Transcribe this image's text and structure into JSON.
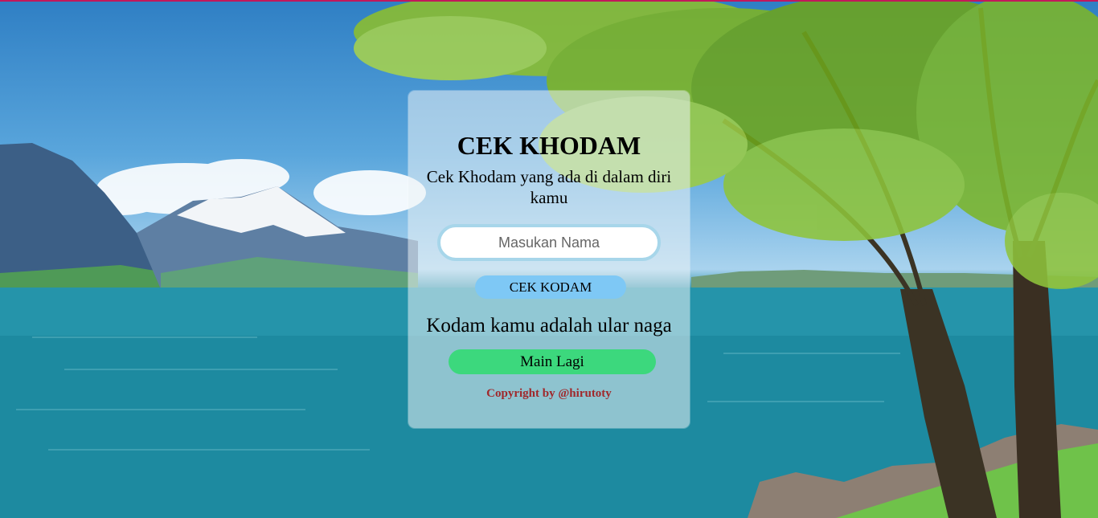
{
  "app": {
    "title": "CEK KHODAM",
    "subtitle": "Cek Khodam yang ada di dalam diri kamu"
  },
  "form": {
    "name_placeholder": "Masukan Nama",
    "name_value": "",
    "check_label": "CEK KODAM"
  },
  "result": {
    "text": "Kodam kamu adalah ular naga",
    "again_label": "Main Lagi"
  },
  "footer": {
    "copyright": "Copyright by @hirutoty"
  },
  "background": {
    "icon": "landscape-lake-mountain-tree-image"
  },
  "colors": {
    "accent_strip": "#c2185b",
    "check_button": "#7ec8f5",
    "again_button": "#3cd87d",
    "copyright_text": "#a0282b",
    "input_border": "#a7d6ea"
  }
}
